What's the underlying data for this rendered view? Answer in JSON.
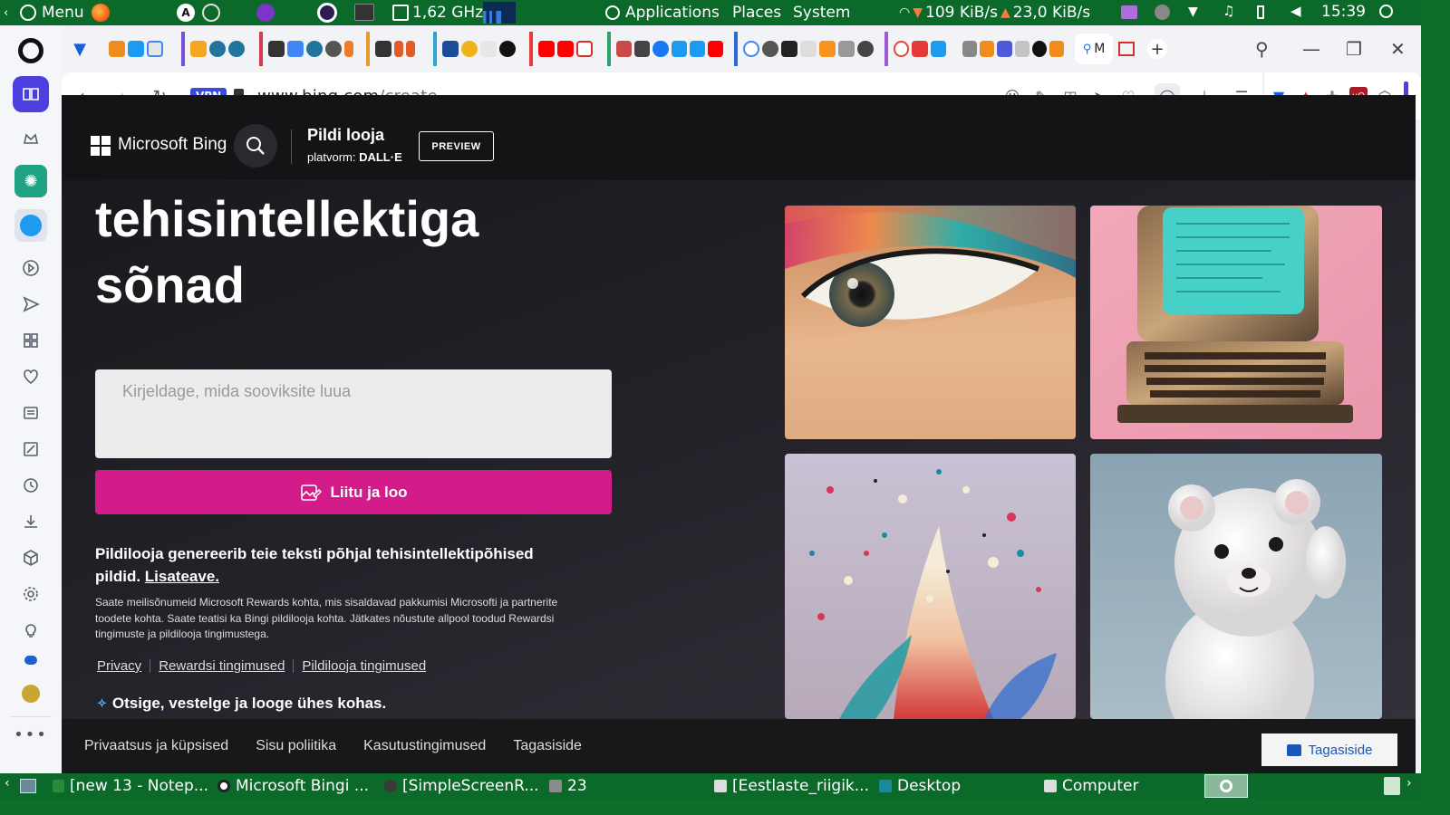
{
  "os_top": {
    "menu_label": "Menu",
    "cpu": "1,62 GHz",
    "apps": "Applications",
    "places": "Places",
    "system": "System",
    "down_speed": "109 KiB/s",
    "up_speed": "23,0 KiB/s",
    "clock": "15:39"
  },
  "browser": {
    "url_host": "www.bing.com",
    "url_path": "/create",
    "vpn": "VPN",
    "active_tab": "M"
  },
  "page": {
    "brand": "Microsoft Bing",
    "app_title": "Pildi looja",
    "app_sub_prefix": "platvorm:",
    "app_sub_model": "DALL·E",
    "preview": "PREVIEW",
    "hero_line1": "tehisintellektiga",
    "hero_line2": "sõnad",
    "prompt_placeholder": "Kirjeldage, mida sooviksite luua",
    "create_button": "Liitu ja loo",
    "desc_text": "Pildilooja genereerib teie teksti põhjal tehisintellektipõhised pildid.",
    "desc_link": "Lisateave.",
    "fine_print": "Saate meilisõnumeid Microsoft Rewards kohta, mis sisaldavad pakkumisi Microsofti ja partnerite toodete kohta. Saate teatisi ka Bingi pildilooja kohta. Jätkates nõustute allpool toodud Rewardsi tingimuste ja pildilooja tingimustega.",
    "links": [
      "Privacy",
      "Rewardsi tingimused",
      "Pildilooja tingimused"
    ],
    "tagline": "Otsige, vestelge ja looge ühes kohas."
  },
  "footer": {
    "links": [
      "Privaatsus ja küpsised",
      "Sisu poliitika",
      "Kasutustingimused",
      "Tagasiside"
    ],
    "feedback_button": "Tagasiside"
  },
  "taskbar": {
    "tasks": [
      "[new 13 - Notep...",
      "Microsoft Bingi ...",
      "[SimpleScreenR...",
      "23",
      "[Eestlaste_riigik...",
      "Desktop",
      "Computer"
    ]
  },
  "colors": {
    "os_panel": "#0b6a2a",
    "create_button": "#d31c8a",
    "page_bg": "#1e1d22",
    "vpn_badge": "#3a4cdd"
  }
}
